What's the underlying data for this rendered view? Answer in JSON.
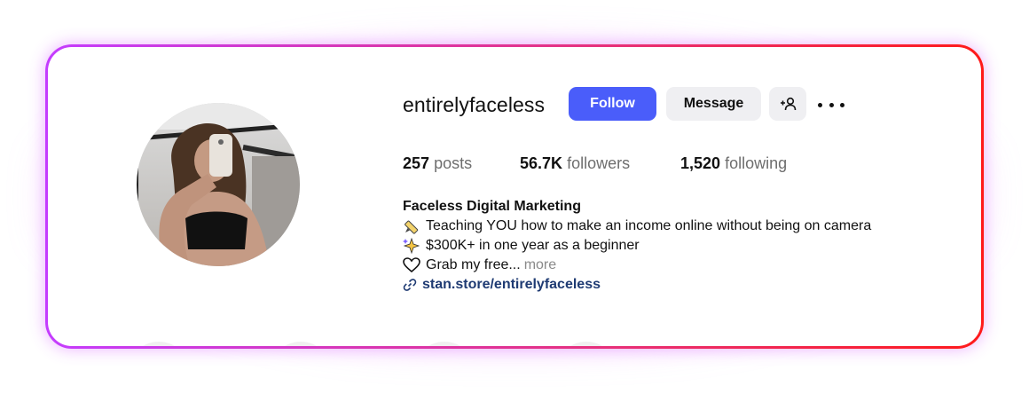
{
  "profile": {
    "username": "entirelyfaceless",
    "follow_label": "Follow",
    "message_label": "Message",
    "stats": {
      "posts_value": "257",
      "posts_label": "posts",
      "followers_value": "56.7K",
      "followers_label": "followers",
      "following_value": "1,520",
      "following_label": "following"
    },
    "bio": {
      "name": "Faceless Digital Marketing",
      "line1": "Teaching YOU how to make an income online without being on camera",
      "line2": "$300K+ in one year as a beginner",
      "line3": "Grab my free...",
      "more": "more",
      "link": "stan.store/entirelyfaceless"
    },
    "icons": {
      "line1": "pencil-icon",
      "line2": "sparkles-icon",
      "line3": "heart-icon",
      "link": "link-icon",
      "add_user": "add-user-icon",
      "more": "more-options-icon"
    }
  },
  "colors": {
    "follow_button": "#4a5dfa",
    "secondary_button": "#efeff2",
    "frame_gradient_start": "#c43cff",
    "frame_gradient_end": "#ff1a1a",
    "link": "#1f3b73"
  }
}
